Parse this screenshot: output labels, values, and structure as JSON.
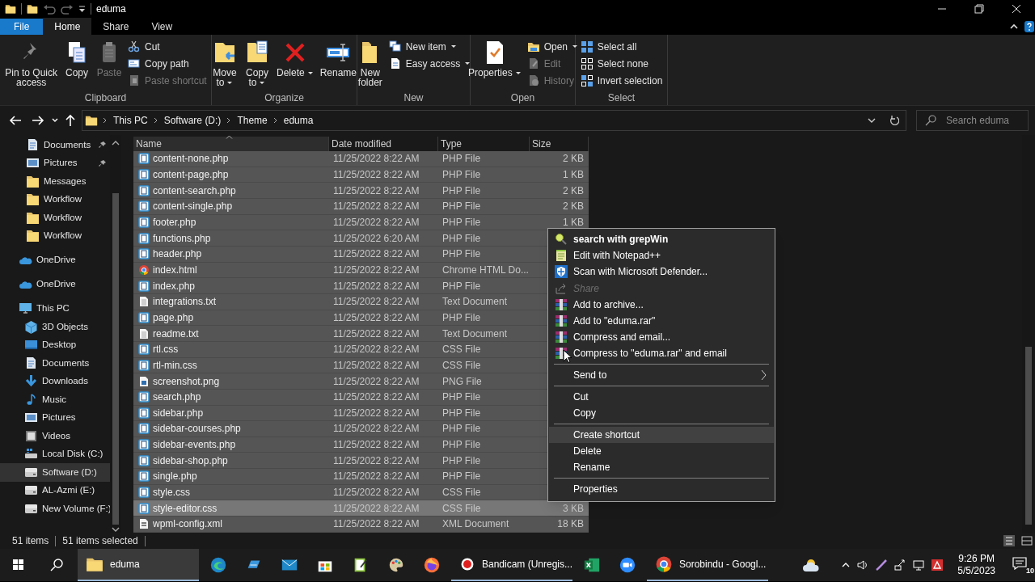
{
  "window": {
    "title": "eduma"
  },
  "ribbon_tabs": [
    {
      "label": "File",
      "kind": "file",
      "selected": false
    },
    {
      "label": "Home",
      "kind": "tab",
      "selected": true
    },
    {
      "label": "Share",
      "kind": "tab",
      "selected": false
    },
    {
      "label": "View",
      "kind": "tab",
      "selected": false
    }
  ],
  "ribbon": {
    "groups": [
      {
        "label": "Clipboard",
        "items": [
          {
            "label": "Pin to Quick access",
            "kind": "large",
            "disabled": false,
            "dropdown": false
          },
          {
            "label": "Copy",
            "kind": "large",
            "disabled": false,
            "dropdown": false
          },
          {
            "label": "Paste",
            "kind": "large",
            "disabled": true,
            "dropdown": false
          },
          {
            "label": "Cut",
            "kind": "small",
            "disabled": false,
            "dropdown": false
          },
          {
            "label": "Copy path",
            "kind": "small",
            "disabled": false,
            "dropdown": false
          },
          {
            "label": "Paste shortcut",
            "kind": "small",
            "disabled": true,
            "dropdown": false
          }
        ]
      },
      {
        "label": "Organize",
        "items": [
          {
            "label": "Move to",
            "kind": "large",
            "disabled": false,
            "dropdown": true
          },
          {
            "label": "Copy to",
            "kind": "large",
            "disabled": false,
            "dropdown": true
          },
          {
            "label": "Delete",
            "kind": "large",
            "disabled": false,
            "dropdown": true
          },
          {
            "label": "Rename",
            "kind": "large",
            "disabled": false,
            "dropdown": false
          }
        ]
      },
      {
        "label": "New",
        "items": [
          {
            "label": "New folder",
            "kind": "large",
            "disabled": false,
            "dropdown": false
          },
          {
            "label": "New item",
            "kind": "small",
            "disabled": false,
            "dropdown": true
          },
          {
            "label": "Easy access",
            "kind": "small",
            "disabled": false,
            "dropdown": true
          }
        ]
      },
      {
        "label": "Open",
        "items": [
          {
            "label": "Properties",
            "kind": "large",
            "disabled": false,
            "dropdown": true
          },
          {
            "label": "Open",
            "kind": "small",
            "disabled": false,
            "dropdown": true
          },
          {
            "label": "Edit",
            "kind": "small",
            "disabled": true,
            "dropdown": false
          },
          {
            "label": "History",
            "kind": "small",
            "disabled": true,
            "dropdown": false
          }
        ]
      },
      {
        "label": "Select",
        "items": [
          {
            "label": "Select all",
            "kind": "small",
            "disabled": false,
            "dropdown": false
          },
          {
            "label": "Select none",
            "kind": "small",
            "disabled": false,
            "dropdown": false
          },
          {
            "label": "Invert selection",
            "kind": "small",
            "disabled": false,
            "dropdown": false
          }
        ]
      }
    ]
  },
  "address": {
    "path": [
      "This PC",
      "Software (D:)",
      "Theme",
      "eduma"
    ],
    "search": {
      "placeholder": "Search eduma"
    }
  },
  "sidebar": {
    "items": [
      {
        "label": "Documents",
        "kind": "documents",
        "pinned": true,
        "selected": false
      },
      {
        "label": "Pictures",
        "kind": "pictures",
        "pinned": true,
        "selected": false
      },
      {
        "label": "Messages",
        "kind": "folder",
        "pinned": false,
        "selected": false
      },
      {
        "label": "Workflow",
        "kind": "folder",
        "pinned": false,
        "selected": false
      },
      {
        "label": "Workflow",
        "kind": "folder",
        "pinned": false,
        "selected": false
      },
      {
        "label": "Workflow",
        "kind": "folder",
        "pinned": false,
        "selected": false
      }
    ],
    "roots": [
      {
        "label": "OneDrive",
        "kind": "cloud",
        "selected": false
      },
      {
        "label": "OneDrive",
        "kind": "cloud",
        "selected": false
      },
      {
        "label": "This PC",
        "kind": "computer",
        "selected": false,
        "children": [
          {
            "label": "3D Objects",
            "kind": "cube",
            "selected": false
          },
          {
            "label": "Desktop",
            "kind": "desktop",
            "selected": false
          },
          {
            "label": "Documents",
            "kind": "documents",
            "selected": false
          },
          {
            "label": "Downloads",
            "kind": "downloads",
            "selected": false
          },
          {
            "label": "Music",
            "kind": "music",
            "selected": false
          },
          {
            "label": "Pictures",
            "kind": "pictures",
            "selected": false
          },
          {
            "label": "Videos",
            "kind": "videos",
            "selected": false
          },
          {
            "label": "Local Disk (C:)",
            "kind": "system-drive",
            "selected": false
          },
          {
            "label": "Software (D:)",
            "kind": "drive",
            "selected": true
          },
          {
            "label": "AL-Azmi (E:)",
            "kind": "drive",
            "selected": false
          },
          {
            "label": "New Volume (F:)",
            "kind": "drive",
            "selected": false
          }
        ]
      }
    ]
  },
  "table": {
    "columns": [
      {
        "label": "Name",
        "sorted": true
      },
      {
        "label": "Date modified",
        "sorted": false
      },
      {
        "label": "Type",
        "sorted": false
      },
      {
        "label": "Size",
        "sorted": false
      }
    ],
    "rows": [
      {
        "name": "content-none.php",
        "date": "11/25/2022 8:22 AM",
        "type": "PHP File",
        "size": "2 KB",
        "kind": "php",
        "selected": true,
        "hovered": false
      },
      {
        "name": "content-page.php",
        "date": "11/25/2022 8:22 AM",
        "type": "PHP File",
        "size": "1 KB",
        "kind": "php",
        "selected": true,
        "hovered": false
      },
      {
        "name": "content-search.php",
        "date": "11/25/2022 8:22 AM",
        "type": "PHP File",
        "size": "2 KB",
        "kind": "php",
        "selected": true,
        "hovered": false
      },
      {
        "name": "content-single.php",
        "date": "11/25/2022 8:22 AM",
        "type": "PHP File",
        "size": "2 KB",
        "kind": "php",
        "selected": true,
        "hovered": false
      },
      {
        "name": "footer.php",
        "date": "11/25/2022 8:22 AM",
        "type": "PHP File",
        "size": "1 KB",
        "kind": "php",
        "selected": true,
        "hovered": false
      },
      {
        "name": "functions.php",
        "date": "11/25/2022 6:20 AM",
        "type": "PHP File",
        "kind": "php",
        "selected": true,
        "hovered": false
      },
      {
        "name": "header.php",
        "date": "11/25/2022 8:22 AM",
        "type": "PHP File",
        "kind": "php",
        "selected": true,
        "hovered": false
      },
      {
        "name": "index.html",
        "date": "11/25/2022 8:22 AM",
        "type": "Chrome HTML Do...",
        "kind": "chrome",
        "selected": true,
        "hovered": false
      },
      {
        "name": "index.php",
        "date": "11/25/2022 8:22 AM",
        "type": "PHP File",
        "kind": "php",
        "selected": true,
        "hovered": false
      },
      {
        "name": "integrations.txt",
        "date": "11/25/2022 8:22 AM",
        "type": "Text Document",
        "kind": "text",
        "selected": true,
        "hovered": false
      },
      {
        "name": "page.php",
        "date": "11/25/2022 8:22 AM",
        "type": "PHP File",
        "kind": "php",
        "selected": true,
        "hovered": false
      },
      {
        "name": "readme.txt",
        "date": "11/25/2022 8:22 AM",
        "type": "Text Document",
        "kind": "text",
        "selected": true,
        "hovered": false
      },
      {
        "name": "rtl.css",
        "date": "11/25/2022 8:22 AM",
        "type": "CSS File",
        "kind": "php",
        "selected": true,
        "hovered": false
      },
      {
        "name": "rtl-min.css",
        "date": "11/25/2022 8:22 AM",
        "type": "CSS File",
        "kind": "php",
        "selected": true,
        "hovered": false
      },
      {
        "name": "screenshot.png",
        "date": "11/25/2022 8:22 AM",
        "type": "PNG File",
        "kind": "image",
        "selected": true,
        "hovered": false
      },
      {
        "name": "search.php",
        "date": "11/25/2022 8:22 AM",
        "type": "PHP File",
        "kind": "php",
        "selected": true,
        "hovered": false
      },
      {
        "name": "sidebar.php",
        "date": "11/25/2022 8:22 AM",
        "type": "PHP File",
        "kind": "php",
        "selected": true,
        "hovered": false
      },
      {
        "name": "sidebar-courses.php",
        "date": "11/25/2022 8:22 AM",
        "type": "PHP File",
        "kind": "php",
        "selected": true,
        "hovered": false
      },
      {
        "name": "sidebar-events.php",
        "date": "11/25/2022 8:22 AM",
        "type": "PHP File",
        "kind": "php",
        "selected": true,
        "hovered": false
      },
      {
        "name": "sidebar-shop.php",
        "date": "11/25/2022 8:22 AM",
        "type": "PHP File",
        "kind": "php",
        "selected": true,
        "hovered": false
      },
      {
        "name": "single.php",
        "date": "11/25/2022 8:22 AM",
        "type": "PHP File",
        "kind": "php",
        "selected": true,
        "hovered": false
      },
      {
        "name": "style.css",
        "date": "11/25/2022 8:22 AM",
        "type": "CSS File",
        "kind": "php",
        "selected": true,
        "hovered": false
      },
      {
        "name": "style-editor.css",
        "date": "11/25/2022 8:22 AM",
        "type": "CSS File",
        "size": "3 KB",
        "kind": "php",
        "selected": true,
        "hovered": true
      },
      {
        "name": "wpml-config.xml",
        "date": "11/25/2022 8:22 AM",
        "type": "XML Document",
        "size": "18 KB",
        "kind": "xml",
        "selected": true,
        "hovered": false
      }
    ]
  },
  "context_menu": {
    "items": [
      {
        "label": "search with grepWin",
        "kind": "item",
        "bold": true,
        "disabled": false,
        "hovered": false
      },
      {
        "label": "Edit with Notepad++",
        "kind": "item",
        "bold": false,
        "disabled": false,
        "hovered": false
      },
      {
        "label": "Scan with Microsoft Defender...",
        "kind": "item",
        "bold": false,
        "disabled": false,
        "hovered": false
      },
      {
        "label": "Share",
        "kind": "item",
        "bold": false,
        "disabled": true,
        "hovered": false
      },
      {
        "label": "Add to archive...",
        "kind": "item",
        "bold": false,
        "disabled": false,
        "hovered": false
      },
      {
        "label": "Add to \"eduma.rar\"",
        "kind": "item",
        "bold": false,
        "disabled": false,
        "hovered": false
      },
      {
        "label": "Compress and email...",
        "kind": "item",
        "bold": false,
        "disabled": false,
        "hovered": false
      },
      {
        "label": "Compress to \"eduma.rar\" and email",
        "kind": "item",
        "bold": false,
        "disabled": false,
        "hovered": false
      },
      {
        "kind": "separator"
      },
      {
        "label": "Send to",
        "kind": "submenu",
        "bold": false,
        "disabled": false,
        "hovered": false
      },
      {
        "kind": "separator"
      },
      {
        "label": "Cut",
        "kind": "item",
        "bold": false,
        "disabled": false,
        "hovered": false
      },
      {
        "label": "Copy",
        "kind": "item",
        "bold": false,
        "disabled": false,
        "hovered": false
      },
      {
        "kind": "separator"
      },
      {
        "label": "Create shortcut",
        "kind": "item",
        "bold": false,
        "disabled": false,
        "hovered": true
      },
      {
        "label": "Delete",
        "kind": "item",
        "bold": false,
        "disabled": false,
        "hovered": false
      },
      {
        "label": "Rename",
        "kind": "item",
        "bold": false,
        "disabled": false,
        "hovered": false
      },
      {
        "kind": "separator"
      },
      {
        "label": "Properties",
        "kind": "item",
        "bold": false,
        "disabled": false,
        "hovered": false
      }
    ]
  },
  "status_bar": {
    "item_count": "51 items",
    "selection": "51 items selected"
  },
  "taskbar": {
    "apps": [
      {
        "kind": "explorer",
        "label": "eduma",
        "active": true
      },
      {
        "kind": "edge",
        "active": false
      },
      {
        "kind": "app",
        "active": false
      },
      {
        "kind": "mail",
        "active": false
      },
      {
        "kind": "store",
        "active": false
      },
      {
        "kind": "notepad",
        "active": false
      },
      {
        "kind": "paint",
        "active": false
      },
      {
        "kind": "firefox",
        "active": false
      },
      {
        "kind": "record",
        "label": "Bandicam (Unregis...",
        "active": false
      },
      {
        "kind": "excel",
        "active": false
      },
      {
        "kind": "zoom",
        "active": false
      },
      {
        "kind": "chrome",
        "label": "Sorobindu - Googl...",
        "active": false
      }
    ],
    "time": "9:26 PM",
    "date": "5/5/2023",
    "notifications": "10"
  }
}
